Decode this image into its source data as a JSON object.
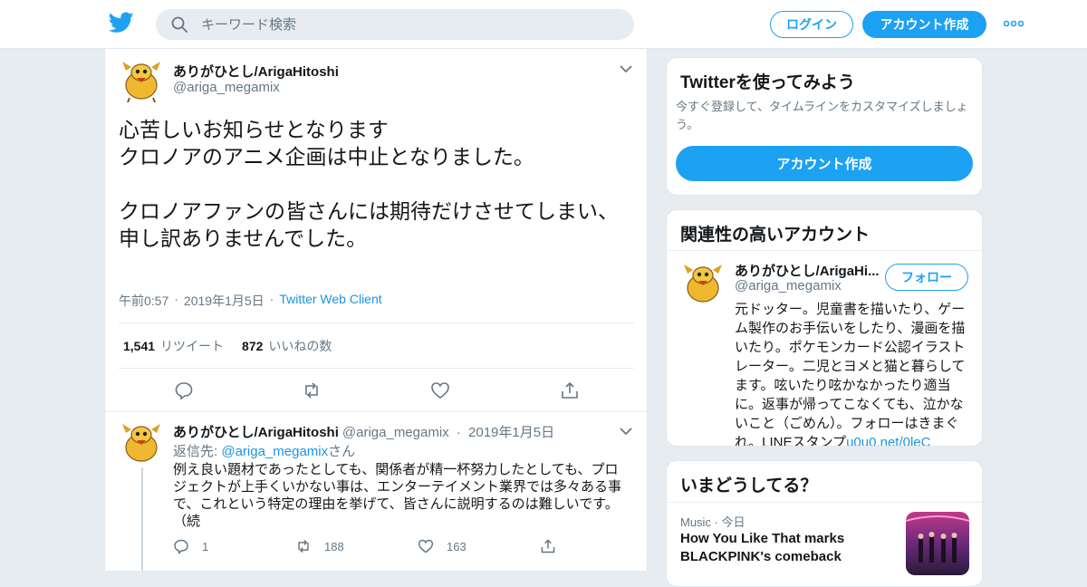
{
  "header": {
    "search_placeholder": "キーワード検索",
    "login_label": "ログイン",
    "signup_label": "アカウント作成"
  },
  "tweet": {
    "author_name": "ありがひとし/ArigaHitoshi",
    "author_handle": "@ariga_megamix",
    "text": "心苦しいお知らせとなります\nクロノアのアニメ企画は中止となりました。\n\nクロノアファンの皆さんには期待だけさせてしまい、\n申し訳ありませんでした。",
    "time": "午前0:57",
    "date": "2019年1月5日",
    "source": "Twitter Web Client",
    "retweets": "1,541",
    "retweets_label": "リツイート",
    "likes": "872",
    "likes_label": "いいねの数"
  },
  "reply": {
    "author_name": "ありがひとし/ArigaHitoshi",
    "author_handle": "@ariga_megamix",
    "date": "2019年1月5日",
    "reply_prefix": "返信先: ",
    "reply_to": "@ariga_megamix",
    "reply_suffix": "さん",
    "text": "例え良い題材であったとしても、関係者が精一杯努力したとしても、プロジェクトが上手くいかない事は、エンターテイメント業界では多々ある事で、これという特定の理由を挙げて、皆さんに説明するのは難しいです。（続",
    "reply_count": "1",
    "retweet_count": "188",
    "like_count": "163"
  },
  "sidebar": {
    "signup_card": {
      "title": "Twitterを使ってみよう",
      "subtitle": "今すぐ登録して、タイムラインをカスタマイズしましょう。",
      "button": "アカウント作成"
    },
    "related": {
      "title": "関連性の高いアカウント",
      "name": "ありがひとし/ArigaHi...",
      "handle": "@ariga_megamix",
      "follow": "フォロー",
      "bio": "元ドッター。児童書を描いたり、ゲーム製作のお手伝いをしたり、漫画を描いたり。ポケモンカード公認イラストレーター。二児とヨメと猫と暮らしてます。呟いたり呟かなかったり適当に。返事が帰ってこなくても、泣かないこと（ごめん）。フォローはきまぐれ。LINEスタンプ",
      "bio_link": "u0u0.net/0leC"
    },
    "trends": {
      "title": "いまどうしてる？",
      "category": "Music",
      "time": "今日",
      "headline": "How You Like That marks BLACKPINK's comeback"
    }
  },
  "colors": {
    "accent": "#1da1f2",
    "link": "#1b95e0",
    "muted": "#657786",
    "background": "#e6ecf0"
  }
}
